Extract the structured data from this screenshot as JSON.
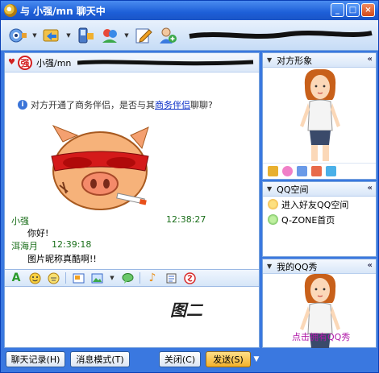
{
  "window": {
    "title": "与 小强/mn 聊天中",
    "controls": {
      "minimize": "_",
      "maximize": "□",
      "close": "×"
    }
  },
  "toolbar": {
    "buttons": [
      {
        "name": "video-icon",
        "has_dropdown": true
      },
      {
        "name": "transfer-icon",
        "has_dropdown": true
      },
      {
        "name": "mobile-icon",
        "has_dropdown": false
      },
      {
        "name": "game-icon",
        "has_dropdown": true
      },
      {
        "name": "edit-icon",
        "has_dropdown": false
      },
      {
        "name": "add-friend-icon",
        "has_dropdown": false
      }
    ]
  },
  "chat": {
    "contact_name": "小强/mn",
    "contact_badge": "强",
    "notice_text": "对方开通了商务伴侣，是否与其",
    "notice_link": "商务伴侣",
    "notice_suffix": "聊聊?",
    "messages": [
      {
        "sender": "小强",
        "time": "12:38:27",
        "text": "你好!"
      },
      {
        "sender": "洱海月",
        "time": "12:39:18",
        "text": "图片昵称真酷啊!!"
      }
    ],
    "format_icons": [
      "font-icon",
      "emoticon-icon",
      "magic-emoticon-icon",
      "screenshot-icon",
      "send-image-icon",
      "chat-bubble-icon",
      "music-icon",
      "scene-icon",
      "sogou-icon"
    ],
    "input_watermark": "图二"
  },
  "bottom": {
    "history_button": "聊天记录(H)",
    "message_mode_button": "消息模式(T)",
    "close_button": "关闭(C)",
    "send_button": "发送(S)"
  },
  "right_panel": {
    "profile_header": "对方形象",
    "qqspace_header": "QQ空间",
    "qqspace_items": [
      "进入好友QQ空间",
      "Q-ZONE首页"
    ],
    "myshow_header": "我的QQ秀",
    "myshow_link": "点击拥有QQ秀",
    "collapse_symbol": "«"
  },
  "colors": {
    "frame_blue": "#3a78e0",
    "title_text": "#ffffff",
    "name_green": "#1a6e1a",
    "link_blue": "#0a2ec8",
    "qqshow_purple": "#b01aa8"
  }
}
